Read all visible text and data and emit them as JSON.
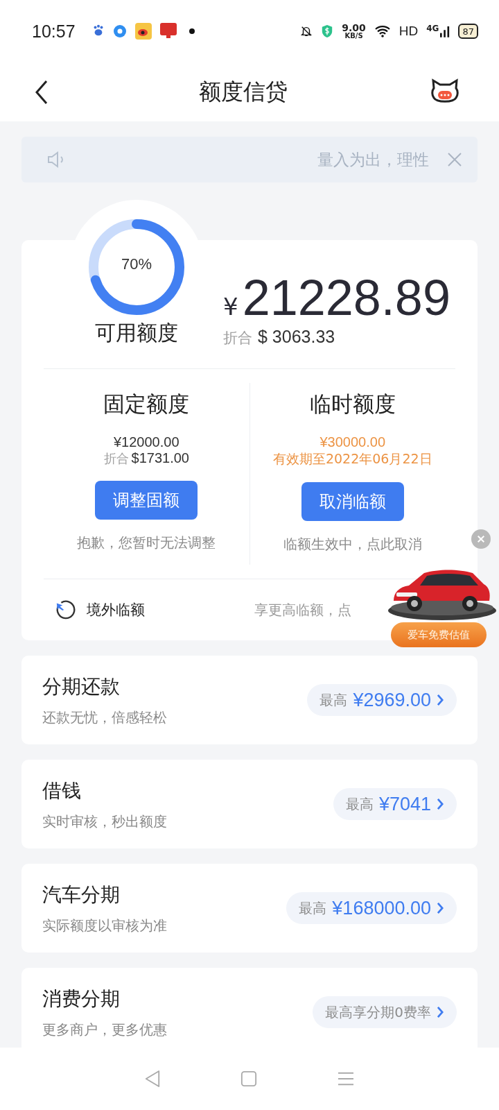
{
  "status_bar": {
    "time": "10:57",
    "net_speed": "9.00",
    "net_unit": "KB/S",
    "hd": "HD",
    "network": "4G",
    "battery": "87"
  },
  "header": {
    "title": "额度信贷"
  },
  "notice": {
    "text": "量入为出，理性"
  },
  "credit": {
    "level": 0.7,
    "percent": "70%",
    "label": "可用额度",
    "currency": "¥",
    "amount": "21228.89",
    "converted_label": "折合",
    "converted": "$ 3063.33"
  },
  "limits": [
    {
      "kind": "fixed",
      "title": "固定额度",
      "amount": "¥12000.00",
      "converted_label": "折合",
      "converted": "$1731.00",
      "button": "调整固额",
      "note": "抱歉，您暂时无法调整"
    },
    {
      "kind": "temporary",
      "title": "临时额度",
      "amount": "¥30000.00",
      "validity": "有效期至2022年06月22日",
      "button": "取消临额",
      "note": "临额生效中，点此取消"
    }
  ],
  "overseas": {
    "label": "境外临额",
    "hint": "享更高临额，点"
  },
  "ad": {
    "label": "爱车免费估值"
  },
  "products": [
    {
      "title": "分期还款",
      "subtitle": "还款无忧，倍感轻松",
      "prefix": "最高",
      "amount": "¥2969.00"
    },
    {
      "title": "借钱",
      "subtitle": "实时审核，秒出额度",
      "prefix": "最高",
      "amount": "¥7041"
    },
    {
      "title": "汽车分期",
      "subtitle": "实际额度以审核为准",
      "prefix": "最高",
      "amount": "¥168000.00"
    },
    {
      "title": "消费分期",
      "subtitle": "更多商户，更多优惠",
      "prefix": "最高享分期0费率"
    }
  ]
}
